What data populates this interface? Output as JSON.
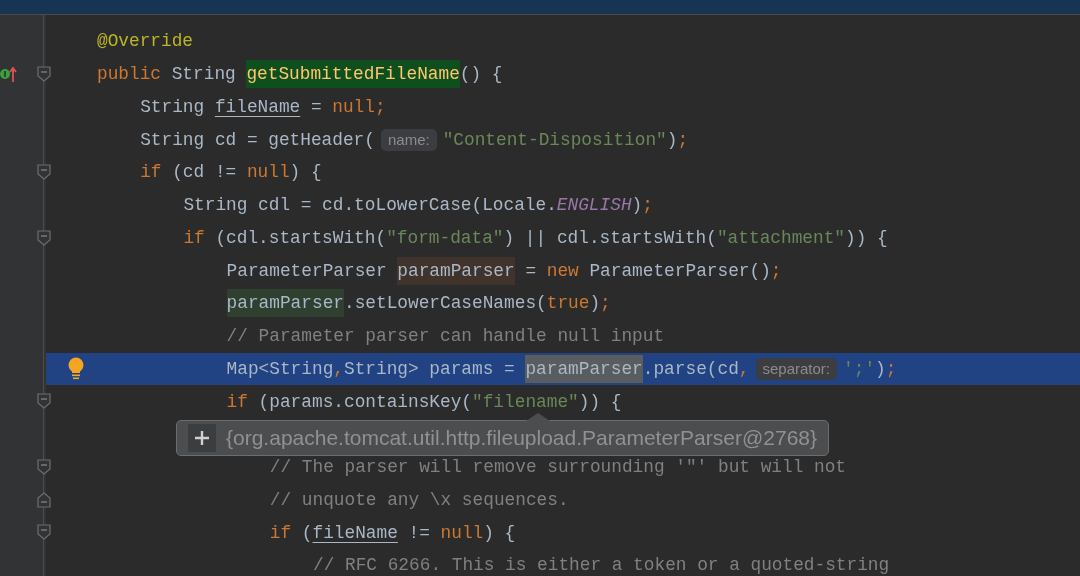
{
  "editor": {
    "lines": [
      {
        "tokens": [
          {
            "text": "@Override",
            "kind": "annotation"
          }
        ]
      },
      {
        "icon": {
          "kind": "override"
        },
        "fold": {
          "kind": "start"
        },
        "tokens": [
          {
            "text": "public",
            "kind": "keyword"
          },
          {
            "text": " String ",
            "kind": "plain"
          },
          {
            "text": "getSubmittedFileName",
            "kind": "method",
            "color": "#0e4f1e"
          },
          {
            "text": "() {",
            "kind": "plain"
          }
        ],
        "children": [
          {
            "tokens": [
              {
                "text": "String ",
                "kind": "plain"
              },
              {
                "text": "fileName",
                "kind": "plain",
                "underline": true
              },
              {
                "text": " = ",
                "kind": "plain"
              },
              {
                "text": "null;",
                "kind": "keyword"
              }
            ]
          },
          {
            "tokens": [
              {
                "text": "String cd = getHeader(",
                "kind": "plain"
              },
              {
                "text": "name:",
                "kind": "hint"
              },
              {
                "text": "\"Content-Disposition\"",
                "kind": "string"
              },
              {
                "text": ")",
                "kind": "plain"
              },
              {
                "text": ";",
                "kind": "keyword"
              }
            ]
          },
          {
            "fold": {
              "kind": "start"
            },
            "tokens": [
              {
                "text": "if",
                "kind": "keyword"
              },
              {
                "text": " (cd != ",
                "kind": "plain"
              },
              {
                "text": "null",
                "kind": "keyword"
              },
              {
                "text": ") {",
                "kind": "plain"
              }
            ],
            "children": [
              {
                "tokens": [
                  {
                    "text": "String cdl = cd.toLowerCase(Locale.",
                    "kind": "plain"
                  },
                  {
                    "text": "ENGLISH",
                    "kind": "constant"
                  },
                  {
                    "text": ")",
                    "kind": "plain"
                  },
                  {
                    "text": ";",
                    "kind": "keyword"
                  }
                ]
              },
              {
                "fold": {
                  "kind": "start"
                },
                "tokens": [
                  {
                    "text": "if",
                    "kind": "keyword"
                  },
                  {
                    "text": " (cdl.startsWith(",
                    "kind": "plain"
                  },
                  {
                    "text": "\"form-data\"",
                    "kind": "string"
                  },
                  {
                    "text": ") || cdl.startsWith(",
                    "kind": "plain"
                  },
                  {
                    "text": "\"attachment\"",
                    "kind": "string"
                  },
                  {
                    "text": ")) {",
                    "kind": "plain"
                  }
                ],
                "children": [
                  {
                    "tokens": [
                      {
                        "text": "ParameterParser ",
                        "kind": "plain"
                      },
                      {
                        "text": "paramParser",
                        "kind": "plain",
                        "color": "#40332b"
                      },
                      {
                        "text": " = ",
                        "kind": "plain"
                      },
                      {
                        "text": "new",
                        "kind": "keyword"
                      },
                      {
                        "text": " ParameterParser()",
                        "kind": "plain"
                      },
                      {
                        "text": ";",
                        "kind": "keyword"
                      }
                    ]
                  },
                  {
                    "tokens": [
                      {
                        "text": "paramParser",
                        "kind": "plain",
                        "color": "#2f3f30"
                      },
                      {
                        "text": ".setLowerCaseNames(",
                        "kind": "plain"
                      },
                      {
                        "text": "true",
                        "kind": "keyword"
                      },
                      {
                        "text": ")",
                        "kind": "plain"
                      },
                      {
                        "text": ";",
                        "kind": "keyword"
                      }
                    ]
                  },
                  {
                    "tokens": [
                      {
                        "text": "// Parameter parser can handle null input",
                        "kind": "comment"
                      }
                    ]
                  },
                  {
                    "selected": true,
                    "icon": {
                      "kind": "bulb"
                    },
                    "tokens": [
                      {
                        "text": "Map<String",
                        "kind": "plain"
                      },
                      {
                        "text": ",",
                        "kind": "keyword"
                      },
                      {
                        "text": "String> params = ",
                        "kind": "plain"
                      },
                      {
                        "text": "paramParser",
                        "kind": "plain",
                        "color": "#5a5d60"
                      },
                      {
                        "text": ".parse(cd",
                        "kind": "plain"
                      },
                      {
                        "text": ",",
                        "kind": "keyword"
                      },
                      {
                        "text": "separator:",
                        "kind": "hint"
                      },
                      {
                        "text": "';'",
                        "kind": "string"
                      },
                      {
                        "text": ")",
                        "kind": "plain"
                      },
                      {
                        "text": ";",
                        "kind": "keyword"
                      }
                    ]
                  },
                  {
                    "fold": {
                      "kind": "start"
                    },
                    "popup": {
                      "text": "{org.apache.tomcat.util.http.fileupload.ParameterParser@2768}"
                    },
                    "tokens": [
                      {
                        "text": "if",
                        "kind": "keyword"
                      },
                      {
                        "text": " (params.containsKey(",
                        "kind": "plain"
                      },
                      {
                        "text": "\"filename\"",
                        "kind": "string"
                      },
                      {
                        "text": ")) {",
                        "kind": "plain"
                      }
                    ],
                    "children": [
                      {
                        "fold": {
                          "kind": "start"
                        },
                        "tokens": [
                          {
                            "text": "// The parser will remove surrounding '\"' but will not",
                            "kind": "comment"
                          }
                        ]
                      },
                      {
                        "fold": {
                          "kind": "end"
                        },
                        "tokens": [
                          {
                            "text": "// unquote any \\x sequences.",
                            "kind": "comment"
                          }
                        ]
                      },
                      {
                        "fold": {
                          "kind": "start"
                        },
                        "tokens": [
                          {
                            "text": "if",
                            "kind": "keyword"
                          },
                          {
                            "text": " (",
                            "kind": "plain"
                          },
                          {
                            "text": "fileName",
                            "kind": "plain",
                            "underline": true
                          },
                          {
                            "text": " != ",
                            "kind": "plain"
                          },
                          {
                            "text": "null",
                            "kind": "keyword"
                          },
                          {
                            "text": ") {",
                            "kind": "plain"
                          }
                        ],
                        "children": [
                          {
                            "tokens": [
                              {
                                "text": "// RFC 6266. This is either a token or a quoted-string",
                                "kind": "comment"
                              }
                            ]
                          }
                        ]
                      }
                    ]
                  }
                ]
              }
            ]
          }
        ]
      }
    ]
  }
}
